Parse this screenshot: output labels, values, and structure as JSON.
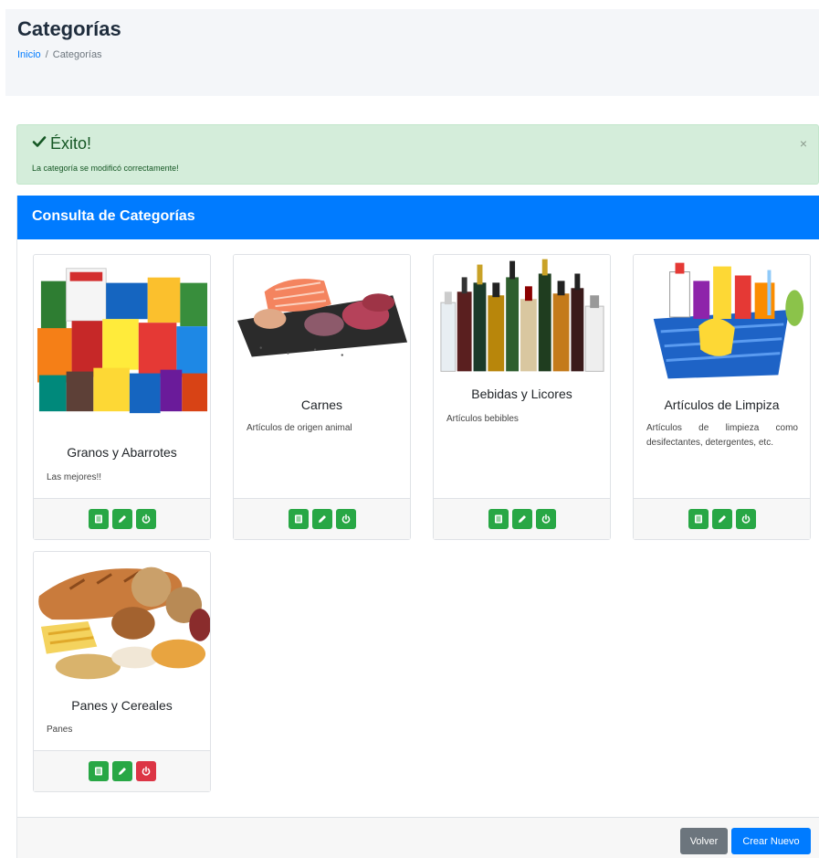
{
  "header": {
    "title": "Categorías",
    "breadcrumb": {
      "home": "Inicio",
      "separator": "/",
      "current": "Categorías"
    }
  },
  "alert": {
    "title": "Éxito!",
    "message": "La categoría se modificó correctamente!",
    "close": "×",
    "icon": "check-icon"
  },
  "panel": {
    "title": "Consulta de Categorías",
    "accent": "#007bff"
  },
  "categories": [
    {
      "name": "Granos y Abarrotes",
      "description": "Las mejores!!",
      "image": "groceries-image",
      "status_active": true
    },
    {
      "name": "Carnes",
      "description": "Artículos de origen animal",
      "image": "meat-image",
      "status_active": true
    },
    {
      "name": "Bebidas y Licores",
      "description": "Artículos bebibles",
      "image": "bottles-image",
      "status_active": true
    },
    {
      "name": "Artículos de Limpiza",
      "description": "Artículos de limpieza como desifectantes, detergentes, etc.",
      "image": "cleaning-image",
      "status_active": true
    },
    {
      "name": "Panes y Cereales",
      "description": "Panes",
      "image": "bread-image",
      "status_active": false
    }
  ],
  "actions": {
    "icons": [
      "list-icon",
      "pencil-icon",
      "power-icon"
    ]
  },
  "footer": {
    "back_label": "Volver",
    "new_label": "Crear Nuevo"
  },
  "colors": {
    "success": "#28a745",
    "danger": "#dc3545",
    "secondary": "#6c757d",
    "alert_bg": "#d4edda"
  }
}
